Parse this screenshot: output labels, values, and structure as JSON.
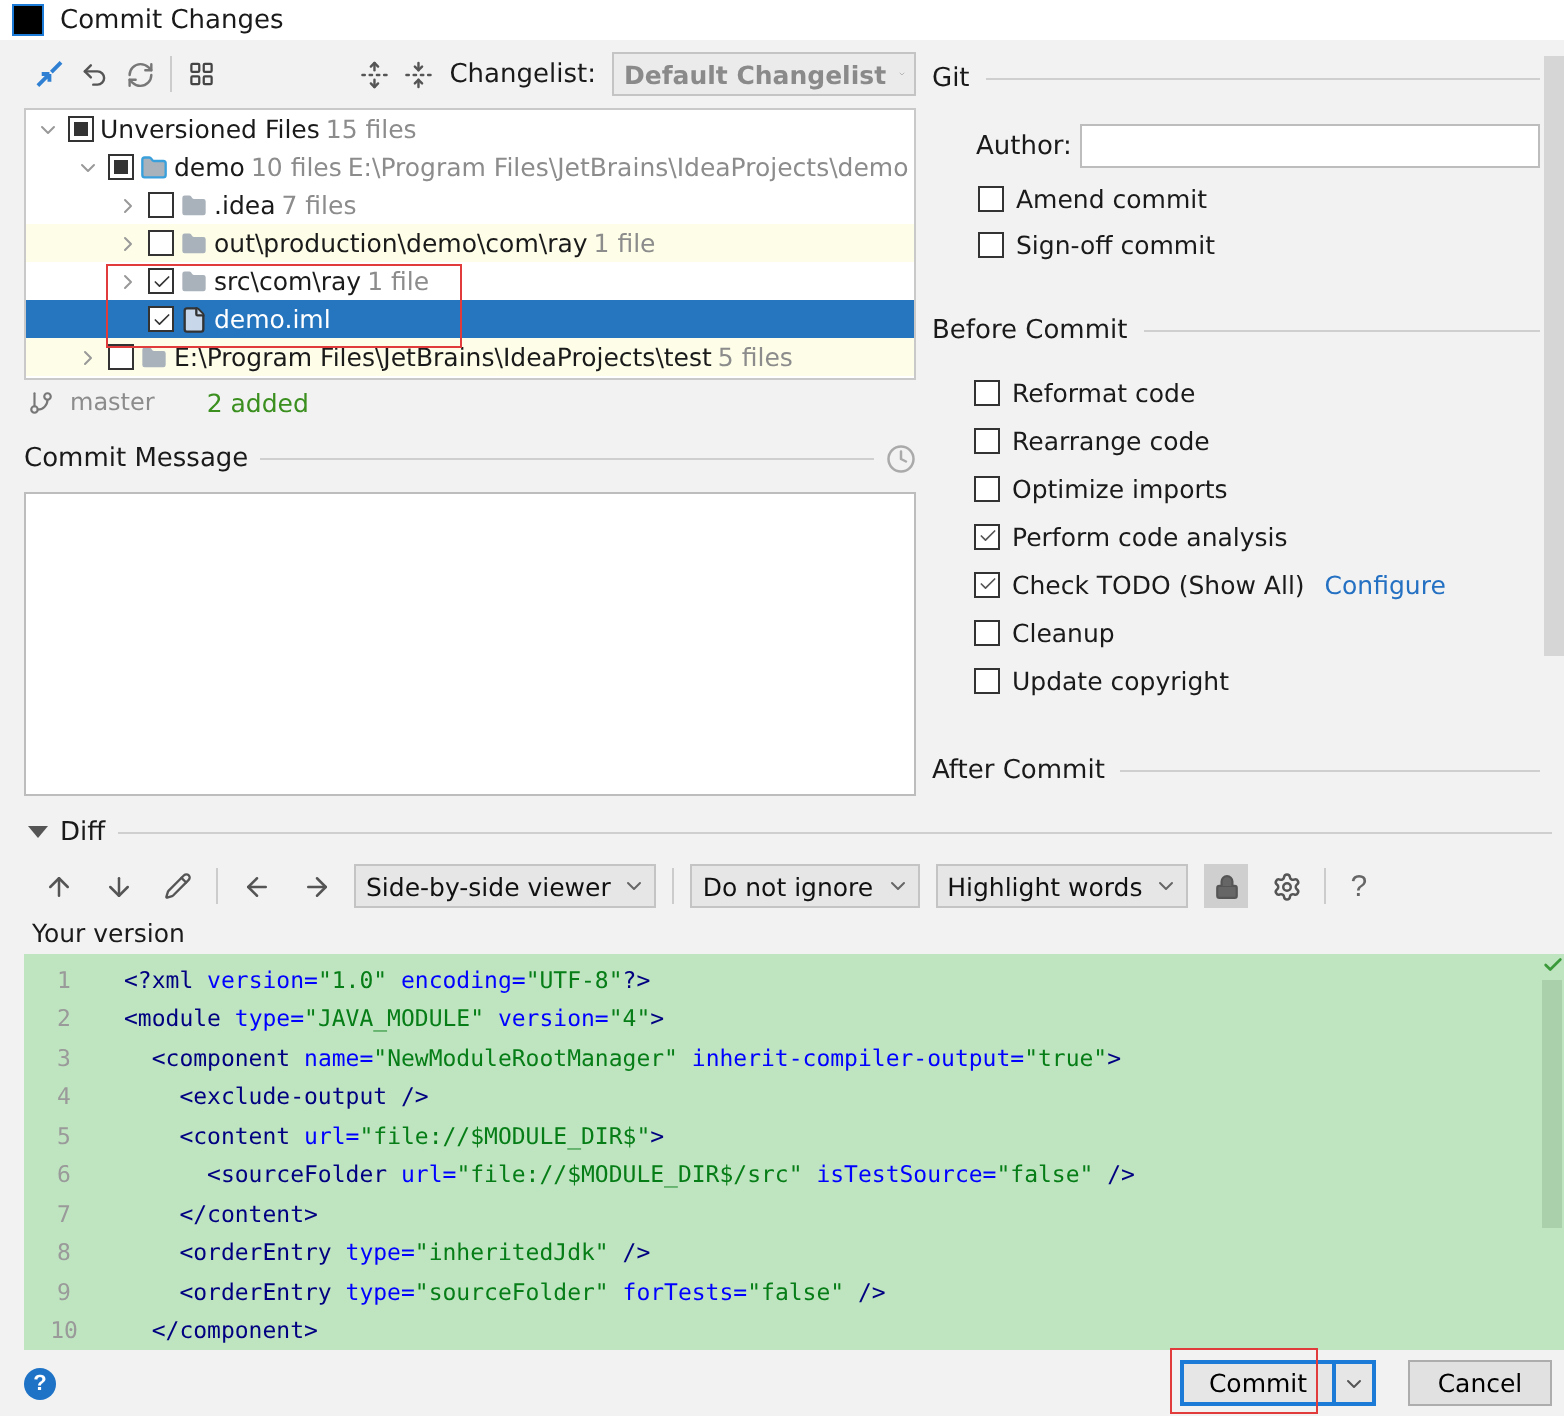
{
  "window": {
    "title": "Commit Changes"
  },
  "toolbar": {
    "changelist_label": "Changelist:",
    "changelist": "Default Changelist"
  },
  "tree": [
    {
      "label": "Unversioned Files",
      "count": "15 files",
      "checked": false,
      "partial": true,
      "expanded": true,
      "selected": false,
      "highlighted": false,
      "children": [
        {
          "label": "demo",
          "count": "10 files",
          "path": "E:\\Program Files\\JetBrains\\IdeaProjects\\demo",
          "kind": "module",
          "checked": false,
          "partial": true,
          "expanded": true,
          "selected": false,
          "highlighted": false,
          "children": [
            {
              "label": ".idea",
              "count": "7 files",
              "kind": "folder",
              "checked": false,
              "expanded": false,
              "selected": false,
              "highlighted": false
            },
            {
              "label": "out\\production\\demo\\com\\ray",
              "count": "1 file",
              "kind": "folder",
              "checked": false,
              "expanded": false,
              "selected": false,
              "highlighted": true
            },
            {
              "label": "src\\com\\ray",
              "count": "1 file",
              "kind": "folder",
              "checked": true,
              "expanded": false,
              "selected": false,
              "highlighted": false
            },
            {
              "label": "demo.iml",
              "kind": "file",
              "checked": true,
              "selected": true,
              "highlighted": false
            }
          ]
        },
        {
          "label": "E:\\Program Files\\JetBrains\\IdeaProjects\\test",
          "count": "5 files",
          "kind": "folder",
          "checked": false,
          "expanded": false,
          "selected": false,
          "highlighted": true
        }
      ]
    }
  ],
  "status": {
    "branch": "master",
    "summary": "2 added"
  },
  "commit_message": {
    "label": "Commit Message"
  },
  "git": {
    "title": "Git",
    "author_label": "Author:",
    "options": [
      {
        "label": "Amend commit",
        "checked": false
      },
      {
        "label": "Sign-off commit",
        "checked": false
      }
    ]
  },
  "before_commit": {
    "title": "Before Commit",
    "options": [
      {
        "label": "Reformat code",
        "checked": false
      },
      {
        "label": "Rearrange code",
        "checked": false
      },
      {
        "label": "Optimize imports",
        "checked": false
      },
      {
        "label": "Perform code analysis",
        "checked": true
      },
      {
        "label": "Check TODO (Show All)",
        "checked": true,
        "link": "Configure"
      },
      {
        "label": "Cleanup",
        "checked": false
      },
      {
        "label": "Update copyright",
        "checked": false
      }
    ]
  },
  "after_commit": {
    "title": "After Commit"
  },
  "diff": {
    "title": "Diff",
    "expanded": true,
    "viewer": "Side-by-side viewer",
    "ignore": "Do not ignore",
    "highlight": "Highlight words",
    "help": "?",
    "version_label": "Your version",
    "lines": [
      {
        "number": "1",
        "tokens": [
          {
            "kind": "tag",
            "text": "<?xml"
          },
          {
            "kind": "attr",
            "text": " version="
          },
          {
            "kind": "value",
            "text": "\"1.0\""
          },
          {
            "kind": "attr",
            "text": " encoding="
          },
          {
            "kind": "value",
            "text": "\"UTF-8\""
          },
          {
            "kind": "tag",
            "text": "?>"
          }
        ]
      },
      {
        "number": "2",
        "tokens": [
          {
            "kind": "tag",
            "text": "<module"
          },
          {
            "kind": "attr",
            "text": " type="
          },
          {
            "kind": "value",
            "text": "\"JAVA_MODULE\""
          },
          {
            "kind": "attr",
            "text": " version="
          },
          {
            "kind": "value",
            "text": "\"4\""
          },
          {
            "kind": "tag",
            "text": ">"
          }
        ]
      },
      {
        "number": "3",
        "tokens": [
          {
            "kind": "tag",
            "text": "  <component"
          },
          {
            "kind": "attr",
            "text": " name="
          },
          {
            "kind": "value",
            "text": "\"NewModuleRootManager\""
          },
          {
            "kind": "attr",
            "text": " inherit-compiler-output="
          },
          {
            "kind": "value",
            "text": "\"true\""
          },
          {
            "kind": "tag",
            "text": ">"
          }
        ]
      },
      {
        "number": "4",
        "tokens": [
          {
            "kind": "tag",
            "text": "    <exclude-output />"
          }
        ]
      },
      {
        "number": "5",
        "tokens": [
          {
            "kind": "tag",
            "text": "    <content"
          },
          {
            "kind": "attr",
            "text": " url="
          },
          {
            "kind": "value",
            "text": "\"file://$MODULE_DIR$\""
          },
          {
            "kind": "tag",
            "text": ">"
          }
        ]
      },
      {
        "number": "6",
        "tokens": [
          {
            "kind": "tag",
            "text": "      <sourceFolder"
          },
          {
            "kind": "attr",
            "text": " url="
          },
          {
            "kind": "value",
            "text": "\"file://$MODULE_DIR$/src\""
          },
          {
            "kind": "attr",
            "text": " isTestSource="
          },
          {
            "kind": "value",
            "text": "\"false\""
          },
          {
            "kind": "tag",
            "text": " />"
          }
        ]
      },
      {
        "number": "7",
        "tokens": [
          {
            "kind": "tag",
            "text": "    </content>"
          }
        ]
      },
      {
        "number": "8",
        "tokens": [
          {
            "kind": "tag",
            "text": "    <orderEntry"
          },
          {
            "kind": "attr",
            "text": " type="
          },
          {
            "kind": "value",
            "text": "\"inheritedJdk\""
          },
          {
            "kind": "tag",
            "text": " />"
          }
        ]
      },
      {
        "number": "9",
        "tokens": [
          {
            "kind": "tag",
            "text": "    <orderEntry"
          },
          {
            "kind": "attr",
            "text": " type="
          },
          {
            "kind": "value",
            "text": "\"sourceFolder\""
          },
          {
            "kind": "attr",
            "text": " forTests="
          },
          {
            "kind": "value",
            "text": "\"false\""
          },
          {
            "kind": "tag",
            "text": " />"
          }
        ]
      },
      {
        "number": "10",
        "tokens": [
          {
            "kind": "tag",
            "text": "  </component>"
          }
        ]
      }
    ]
  },
  "buttons": {
    "commit": "Commit",
    "cancel": "Cancel",
    "help": "?"
  }
}
